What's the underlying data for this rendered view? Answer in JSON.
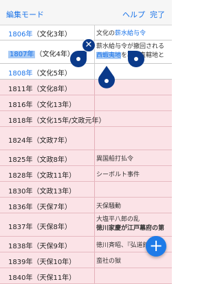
{
  "toolbar": {
    "edit_mode": "編集モード",
    "help": "ヘルプ",
    "done": "完了"
  },
  "rows": [
    {
      "year": "1806年",
      "era": "（文化3年）",
      "event": "文化の",
      "event_link": "薪水給与令",
      "event_line2": ""
    },
    {
      "year": "1807年",
      "era": "（文化4年）",
      "event": "薪水給与令が撤回される",
      "event_link": "西蝦夷地",
      "event_line2": "を幕府直轄地と"
    },
    {
      "year": "1808年",
      "era": "（文化5年）",
      "event": "",
      "event_link": "",
      "event_line2": ""
    },
    {
      "year": "1811年",
      "era": "（文化8年）",
      "event": "",
      "event_link": "",
      "event_line2": ""
    },
    {
      "year": "1816年",
      "era": "（文化13年）",
      "event": "",
      "event_link": "",
      "event_line2": ""
    },
    {
      "year": "1818年",
      "era": "（文化15年/文政元年）",
      "event": "",
      "event_link": "",
      "event_line2": ""
    },
    {
      "year": "1824年",
      "era": "（文政7年）",
      "event": "",
      "event_link": "",
      "event_line2": ""
    },
    {
      "year": "1825年",
      "era": "（文政8年）",
      "event": "異国船打払令",
      "event_link": "",
      "event_line2": ""
    },
    {
      "year": "1828年",
      "era": "（文政11年）",
      "event": "シーボルト事件",
      "event_link": "",
      "event_line2": ""
    },
    {
      "year": "1830年",
      "era": "（文政13年）",
      "event": "",
      "event_link": "",
      "event_line2": ""
    },
    {
      "year": "1836年",
      "era": "（天保7年）",
      "event": "天保騒動",
      "event_link": "",
      "event_line2": ""
    },
    {
      "year": "1837年",
      "era": "（天保8年）",
      "event": "大塩平八郎の乱",
      "event_link": "",
      "event_line2": "徳川家慶が江戸幕府の第"
    },
    {
      "year": "1838年",
      "era": "（天保9年）",
      "event": "徳川斉昭、『弘道館記』",
      "event_link": "",
      "event_line2": ""
    },
    {
      "year": "1839年",
      "era": "（天保10年）",
      "event": "蛮社の獄",
      "event_link": "",
      "event_line2": ""
    },
    {
      "year": "1840年",
      "era": "（天保11年）",
      "event": "",
      "event_link": "",
      "event_line2": ""
    }
  ],
  "icons": {
    "close": "close-icon",
    "add": "plus-icon"
  },
  "symbols": {
    "close": "✕",
    "add": "+"
  },
  "colors": {
    "accent": "#1a73e8",
    "pink_row": "#fbe3e7",
    "handle": "#0b3a8a"
  }
}
